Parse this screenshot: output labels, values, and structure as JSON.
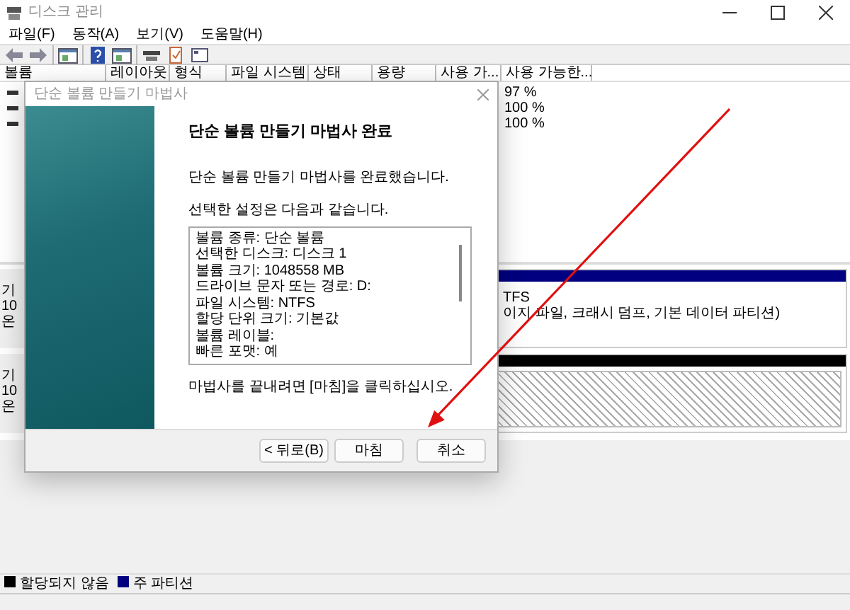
{
  "window": {
    "title": "디스크 관리"
  },
  "menu": [
    "파일(F)",
    "동작(A)",
    "보기(V)",
    "도움말(H)"
  ],
  "volume_table": {
    "columns": [
      "볼륨",
      "레이아웃",
      "형식",
      "파일 시스템",
      "상태",
      "용량",
      "사용 가...",
      "사용 가능한..."
    ],
    "rows": [
      {
        "free_percent": "97 %"
      },
      {
        "free_percent": "100 %"
      },
      {
        "free_percent": "100 %"
      }
    ]
  },
  "disks": [
    {
      "label_lines": [
        "기",
        "10",
        "온"
      ],
      "partition": {
        "kind": "primary",
        "color": "#000080",
        "lines": [
          "TFS",
          "이지 파일, 크래시 덤프, 기본 데이터 파티션)"
        ]
      }
    },
    {
      "label_lines": [
        "기",
        "10",
        "온"
      ],
      "partition": {
        "kind": "unallocated",
        "color": "#000000"
      }
    }
  ],
  "legend": [
    {
      "label": "할당되지 않음",
      "color": "#000000"
    },
    {
      "label": "주 파티션",
      "color": "#000080"
    }
  ],
  "dialog": {
    "title": "단순 볼륨 만들기 마법사",
    "heading": "단순 볼륨 만들기 마법사 완료",
    "intro": "단순 볼륨 만들기 마법사를 완료했습니다.",
    "settings_label": "선택한 설정은 다음과 같습니다.",
    "settings": [
      "볼륨 종류: 단순 볼륨",
      "선택한 디스크: 디스크 1",
      "볼륨 크기: 1048558 MB",
      "드라이브 문자 또는 경로: D:",
      "파일 시스템: NTFS",
      "할당 단위 크기: 기본값",
      "볼륨 레이블:",
      "빠른 포맷: 예"
    ],
    "outro": "마법사를 끝내려면 [마침]을 클릭하십시오.",
    "buttons": [
      {
        "label": "< 뒤로(B)"
      },
      {
        "label": "마침"
      },
      {
        "label": "취소"
      }
    ]
  }
}
